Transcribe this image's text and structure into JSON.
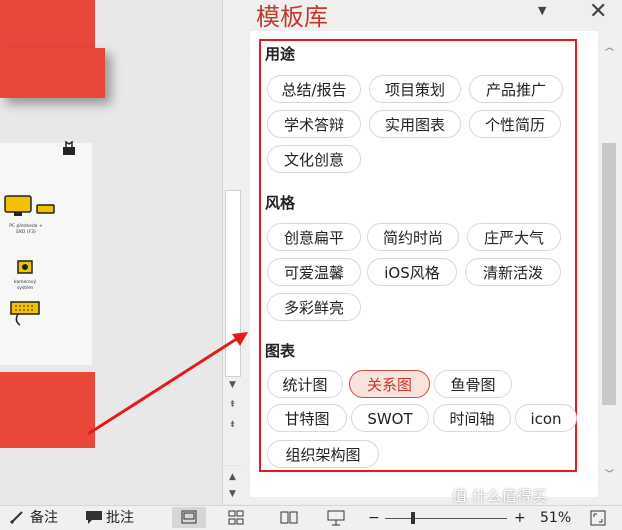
{
  "panel": {
    "title": "模板库",
    "dropdown_icon": "triangle-down-icon",
    "close_icon": "close-icon"
  },
  "slide": {
    "pc_label": "PC předsedа + EKO (F3)",
    "cam_label": "kamerový systém"
  },
  "sections": [
    {
      "title": "用途",
      "tags": [
        "总结/报告",
        "项目策划",
        "产品推广",
        "学术答辩",
        "实用图表",
        "个性简历",
        "文化创意"
      ]
    },
    {
      "title": "风格",
      "tags": [
        "创意扁平",
        "简约时尚",
        "庄严大气",
        "可爱温馨",
        "iOS风格",
        "清新活泼",
        "多彩鲜亮"
      ]
    },
    {
      "title": "图表",
      "tags": [
        "统计图",
        "关系图",
        "鱼骨图",
        "甘特图",
        "SWOT",
        "时间轴",
        "icon",
        "组织架构图"
      ],
      "active": "关系图"
    }
  ],
  "statusbar": {
    "notes_label": "备注",
    "comments_label": "批注",
    "zoom_minus": "−",
    "zoom_plus": "+",
    "zoom_level": "51%"
  },
  "watermark": "值 什么值得买",
  "colors": {
    "accent_red": "#c23a2b",
    "highlight_border": "#e51a1a",
    "slide_red": "#e8473c"
  }
}
